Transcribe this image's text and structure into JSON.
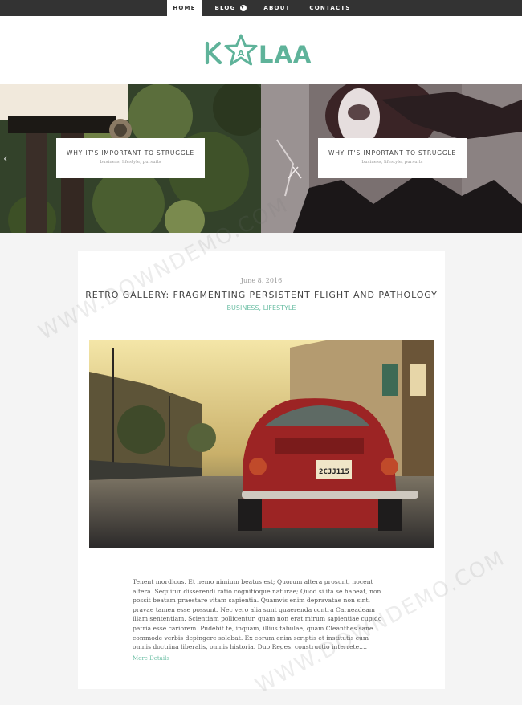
{
  "nav": {
    "items": [
      {
        "label": "HOME",
        "active": true
      },
      {
        "label": "BLOG",
        "has_dropdown": true
      },
      {
        "label": "ABOUT"
      },
      {
        "label": "CONTACTS"
      }
    ]
  },
  "logo": {
    "text": "KALAA",
    "accent_color": "#5fb39a"
  },
  "slider": {
    "slides": [
      {
        "title": "WHY IT'S IMPORTANT TO STRUGGLE",
        "meta": "business, lifestyle, pursuits"
      },
      {
        "title": "WHY IT'S IMPORTANT TO STRUGGLE",
        "meta": "business, lifestyle, pursuits"
      }
    ],
    "prev_icon": "chevron-left-icon"
  },
  "post": {
    "date": "June 8, 2016",
    "title": "RETRO GALLERY: FRAGMENTING PERSISTENT FLIGHT AND PATHOLOGY",
    "categories": "BUSINESS, LIFESTYLE",
    "image_plate": "2CJJ115",
    "excerpt": "Tenent mordicus. Et nemo nimium beatus est; Quorum altera prosunt, nocent altera. Sequitur disserendi ratio cognitioque naturae; Quod si ita se habeat, non possit beatam praestare vitam sapientia. Quamvis enim depravatae non sint, pravae tamen esse possunt. Nec vero alia sunt quaerenda contra Carneadeam illam sententiam. Scientiam pollicentur, quam non erat mirum sapientiae cupido patria esse cariorem. Pudebit te, inquam, illius tabulae, quam Cleanthes sane commode verbis depingere solebat. Ex eorum enim scriptis et institutis cum omnis doctrina liberalis, omnis historia. Duo Reges: constructio interrete.…",
    "more_label": "More Details"
  },
  "watermark": {
    "text": "WWW.DOWNDEMO.COM"
  },
  "colors": {
    "accent": "#6dbfa5",
    "nav_bg": "#333333",
    "page_bg": "#f4f4f4"
  }
}
